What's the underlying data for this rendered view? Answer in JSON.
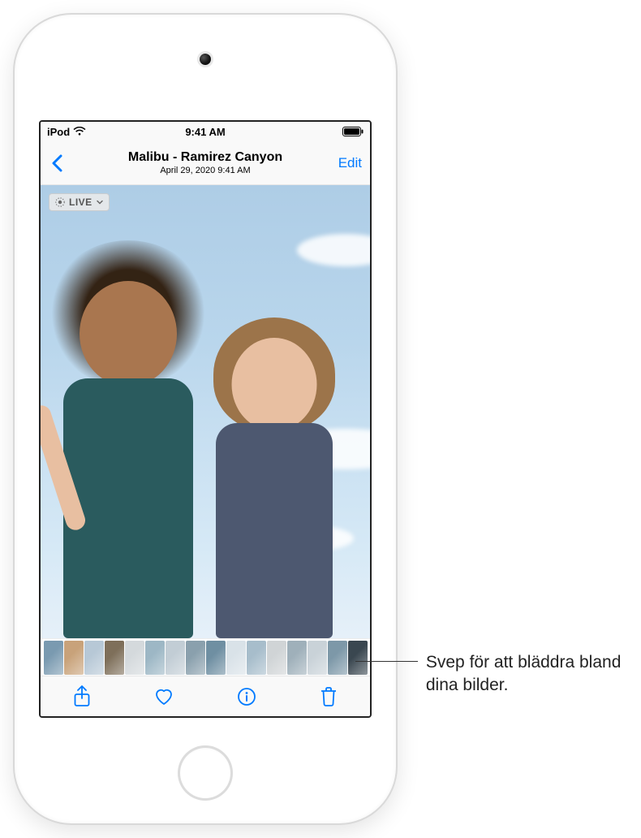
{
  "status_bar": {
    "carrier": "iPod",
    "time": "9:41 AM"
  },
  "nav": {
    "title": "Malibu - Ramirez Canyon",
    "subtitle": "April 29, 2020  9:41 AM",
    "edit_label": "Edit"
  },
  "live_badge": {
    "label": "LIVE"
  },
  "thumbnails": [
    {
      "bg": "#7a9ab0"
    },
    {
      "bg": "#c8a27a"
    },
    {
      "bg": "#b7c8d6"
    },
    {
      "bg": "#7e6f5a"
    },
    {
      "bg": "#d4d9dc"
    },
    {
      "bg": "#9db7c5"
    },
    {
      "bg": "#c2cdd5"
    },
    {
      "bg": "#8aa0ad"
    },
    {
      "bg": "#6f8fa2"
    },
    {
      "bg": "#d9e2e8"
    },
    {
      "bg": "#a7bdcb"
    },
    {
      "bg": "#d0d4d6"
    },
    {
      "bg": "#9fb0ba"
    },
    {
      "bg": "#c9d2d8"
    },
    {
      "bg": "#7d98a8"
    },
    {
      "bg": "#3a4750"
    }
  ],
  "callout": {
    "text": "Svep för att bläddra bland dina bilder."
  }
}
